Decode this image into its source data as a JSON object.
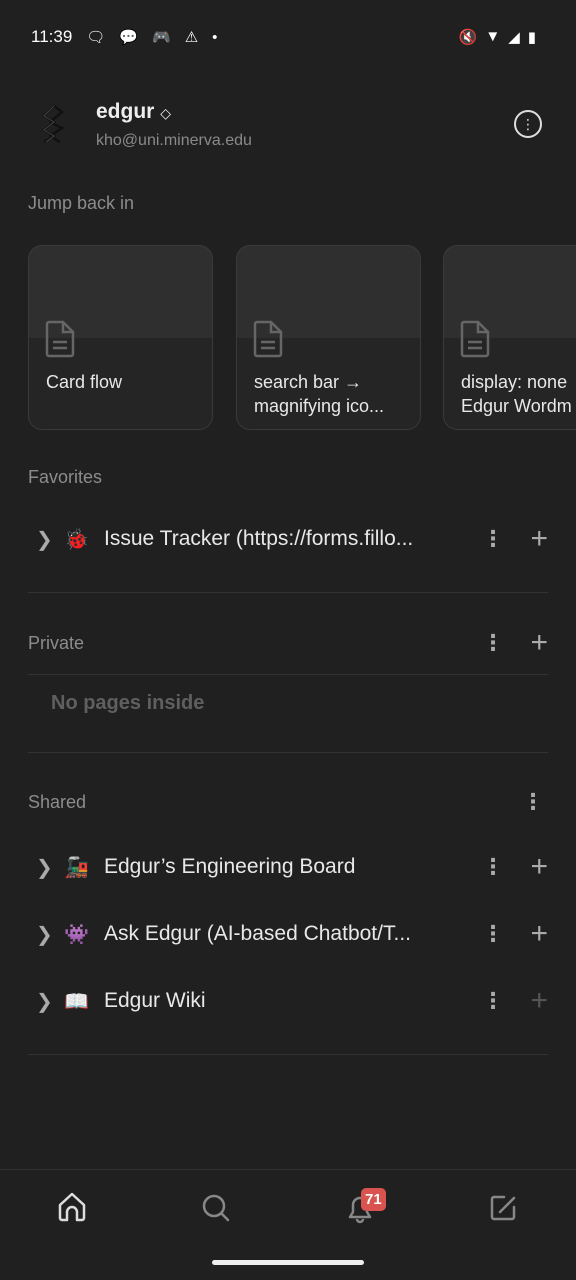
{
  "status_bar": {
    "time": "11:39",
    "icons": [
      "chat-bubble-icon",
      "messages-icon",
      "discord-icon",
      "warning-icon",
      "dot-icon"
    ],
    "right_icons": [
      "mute-icon",
      "wifi-icon",
      "signal-icon",
      "battery-icon"
    ]
  },
  "workspace": {
    "name": "edgur",
    "email": "kho@uni.minerva.edu"
  },
  "jump_back_in": {
    "title": "Jump back in",
    "cards": [
      {
        "title": "Card flow"
      },
      {
        "title": "search bar →\nmagnifying ico..."
      },
      {
        "title": "display: none\nEdgur Wordm"
      }
    ]
  },
  "favorites": {
    "title": "Favorites",
    "items": [
      {
        "emoji": "🐞",
        "label": "Issue Tracker (https://forms.fillo..."
      }
    ]
  },
  "private": {
    "title": "Private",
    "empty": "No pages inside"
  },
  "shared": {
    "title": "Shared",
    "items": [
      {
        "emoji": "🚂",
        "label": "Edgur’s Engineering Board"
      },
      {
        "emoji": "👾",
        "label": "Ask Edgur (AI-based Chatbot/T..."
      },
      {
        "emoji": "📖",
        "label": "Edgur Wiki"
      }
    ]
  },
  "bottom_nav": {
    "items": [
      "home",
      "search",
      "notifications",
      "new-page"
    ],
    "notification_count": "71",
    "badge_color": "#d9534f"
  }
}
